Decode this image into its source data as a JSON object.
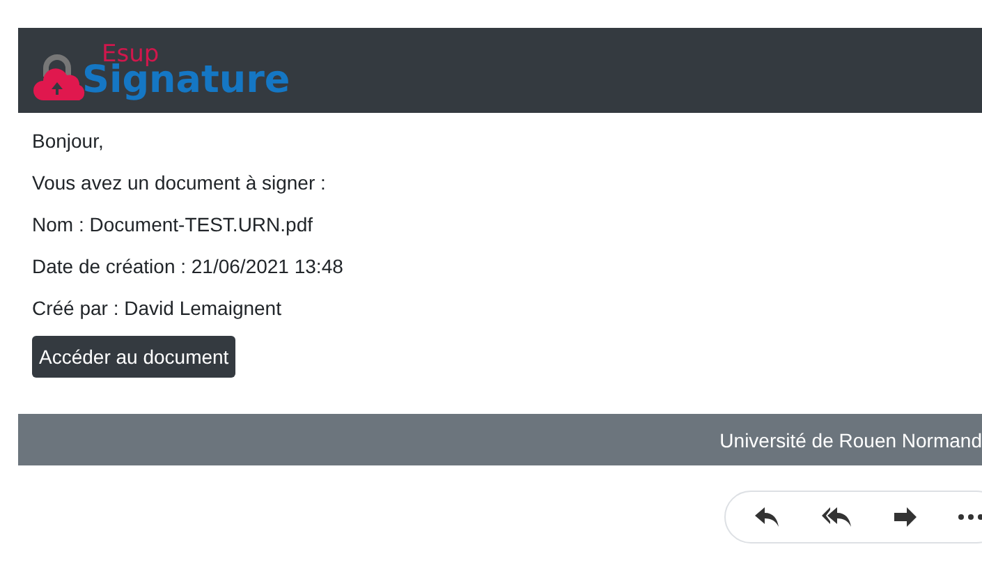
{
  "logo": {
    "top": "Esup",
    "bottom": "Signature"
  },
  "lines": [
    "Bonjour,",
    "Vous avez un document à signer :",
    "Nom : Document-TEST.URN.pdf",
    "Date de création : 21/06/2021 13:48",
    "Créé par : David Lemaignent"
  ],
  "button": "Accéder au document",
  "footer": "Université de Rouen Normand",
  "actions": [
    {
      "kind": "reply"
    },
    {
      "kind": "reply-all"
    },
    {
      "kind": "forward"
    },
    {
      "kind": "more"
    }
  ]
}
